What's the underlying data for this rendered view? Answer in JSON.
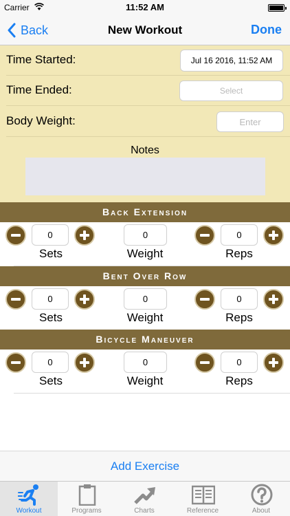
{
  "status_bar": {
    "carrier": "Carrier",
    "time": "11:52 AM"
  },
  "nav": {
    "back_label": "Back",
    "title": "New Workout",
    "done_label": "Done"
  },
  "form": {
    "time_started_label": "Time Started:",
    "time_started_value": "Jul 16 2016, 11:52 AM",
    "time_ended_label": "Time Ended:",
    "time_ended_placeholder": "Select",
    "body_weight_label": "Body Weight:",
    "body_weight_placeholder": "Enter",
    "notes_label": "Notes"
  },
  "exercises": [
    {
      "name": "Back Extension",
      "sets": "0",
      "weight": "0",
      "reps": "0"
    },
    {
      "name": "Bent Over Row",
      "sets": "0",
      "weight": "0",
      "reps": "0"
    },
    {
      "name": "Bicycle Maneuver",
      "sets": "0",
      "weight": "0",
      "reps": "0"
    }
  ],
  "captions": {
    "sets": "Sets",
    "weight": "Weight",
    "reps": "Reps"
  },
  "add_exercise_label": "Add Exercise",
  "tabs": [
    {
      "label": "Workout",
      "icon": "runner-icon",
      "active": true
    },
    {
      "label": "Programs",
      "icon": "clipboard-icon",
      "active": false
    },
    {
      "label": "Charts",
      "icon": "trend-arrow-icon",
      "active": false
    },
    {
      "label": "Reference",
      "icon": "book-icon",
      "active": false
    },
    {
      "label": "About",
      "icon": "question-icon",
      "active": false
    }
  ],
  "colors": {
    "accent": "#1a7ff2",
    "form_background": "#f2e8b7",
    "section_header": "#7f6a3b",
    "stepper_button": "#6f5420"
  }
}
